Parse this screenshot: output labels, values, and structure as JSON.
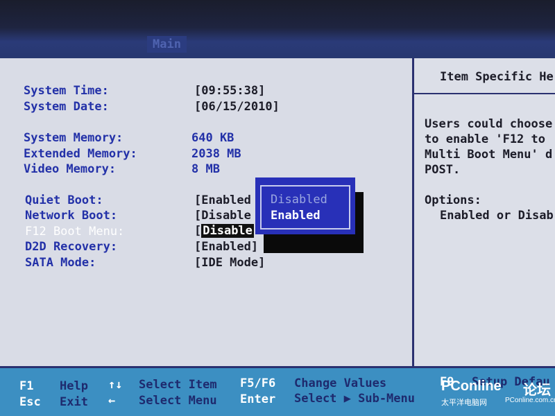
{
  "tabs": {
    "main": "Main"
  },
  "system": {
    "time_label": "System Time:",
    "time_value": "[09:55:38]",
    "date_label": "System Date:",
    "date_value": "[06/15/2010]"
  },
  "memory": {
    "system_label": "System Memory:",
    "system_value": "640 KB",
    "extended_label": "Extended Memory:",
    "extended_value": "2038 MB",
    "video_label": "Video Memory:",
    "video_value": "8 MB"
  },
  "options": {
    "quiet_boot_label": "Quiet Boot:",
    "quiet_boot_value": "[Enabled",
    "network_boot_label": "Network Boot:",
    "network_boot_value": "[Disable",
    "f12_label": "F12 Boot Menu:",
    "f12_bracket": "[",
    "f12_value": "Disable",
    "d2d_label": "D2D Recovery:",
    "d2d_value": "[Enabled]",
    "sata_label": "SATA Mode:",
    "sata_value": "[IDE Mode]"
  },
  "popup": {
    "options": [
      "Disabled",
      "Enabled"
    ],
    "selected": "Enabled"
  },
  "help": {
    "title": "Item Specific He",
    "lines": [
      "Users could choose",
      "to enable 'F12 to",
      "Multi Boot Menu' d",
      "POST."
    ],
    "options_label": "Options:",
    "options_text": "Enabled or Disab"
  },
  "footer": {
    "row1": [
      {
        "key": "F1",
        "desc": "Help"
      },
      {
        "key": "↑↓",
        "desc": "Select Item"
      },
      {
        "key": "F5/F6",
        "desc": "Change Values"
      },
      {
        "key": "F9",
        "desc": "Setup Defau"
      }
    ],
    "row2": [
      {
        "key": "Esc",
        "desc": "Exit"
      },
      {
        "key": "←",
        "desc": "Select Menu"
      },
      {
        "key": "Enter",
        "desc": "Select ▶ Sub-Menu"
      }
    ]
  },
  "watermark": {
    "brand": "PConline",
    "sub": "太平洋电脑网",
    "cn": "论坛",
    "url": "PConline.com.cn"
  },
  "colors": {
    "label_blue": "#2331a8",
    "popup_bg": "#2830b8",
    "footer_bg": "#3c8fc2"
  }
}
